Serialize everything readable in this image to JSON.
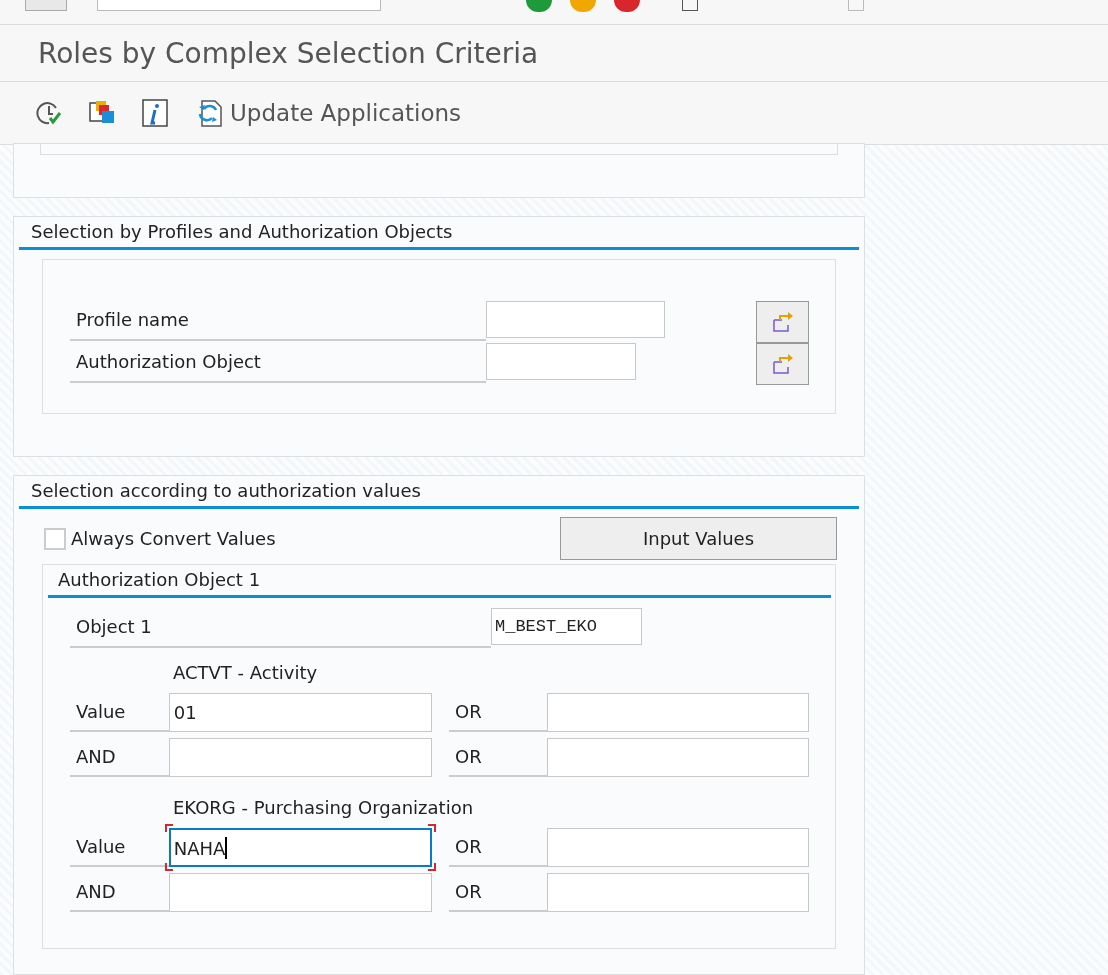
{
  "title": "Roles by Complex Selection Criteria",
  "toolbar": [
    {
      "kind": "execute"
    },
    {
      "kind": "copy"
    },
    {
      "kind": "info"
    },
    {
      "kind": "update",
      "label": "Update Applications"
    }
  ],
  "profiles_section": {
    "title": "Selection by Profiles and Authorization Objects",
    "fields": [
      {
        "label": "Profile name",
        "kind": "long"
      },
      {
        "label": "Authorization Object",
        "kind": "short"
      }
    ]
  },
  "values_section": {
    "title": "Selection according to authorization values",
    "always_convert": {
      "label": "Always Convert Values",
      "checked": false
    },
    "input_button": "Input Values",
    "object": {
      "title": "Authorization Object 1",
      "label": "Object 1",
      "value": "M_BEST_EKO",
      "fields": [
        {
          "title": "ACTVT - Activity",
          "rows": [
            {
              "label": "Value",
              "value": "01",
              "focused": false,
              "or_label": "OR"
            },
            {
              "label": "AND",
              "focused": false,
              "or_label": "OR"
            }
          ]
        },
        {
          "title": "EKORG - Purchasing Organization",
          "rows": [
            {
              "label": "Value",
              "value": "NAHA",
              "focused": true,
              "or_label": "OR"
            },
            {
              "label": "AND",
              "focused": false,
              "or_label": "OR"
            }
          ]
        }
      ]
    }
  }
}
